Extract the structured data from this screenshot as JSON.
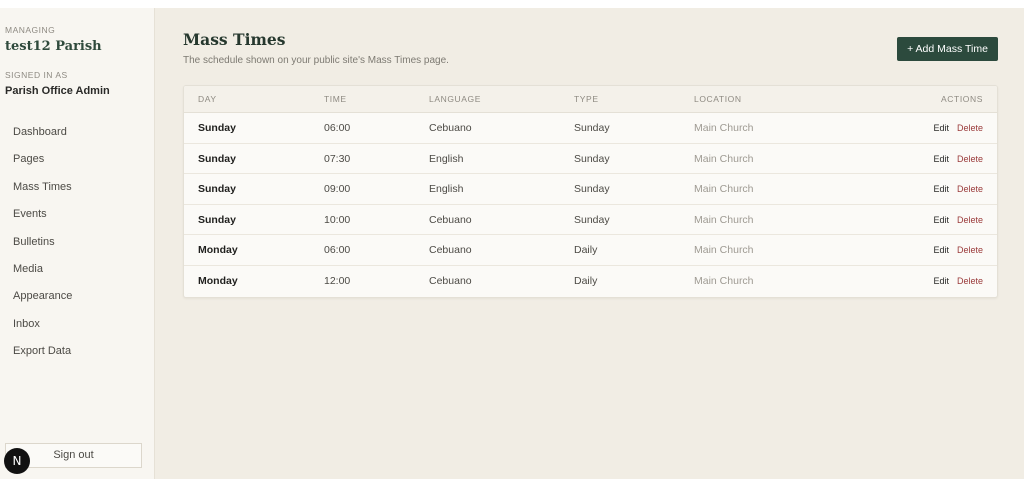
{
  "sidebar": {
    "managing_label": "MANAGING",
    "parish_name": "test12 Parish",
    "signed_in_label": "SIGNED IN AS",
    "user_name": "Parish Office Admin",
    "nav": [
      "Dashboard",
      "Pages",
      "Mass Times",
      "Events",
      "Bulletins",
      "Media",
      "Appearance",
      "Inbox",
      "Export Data"
    ],
    "sign_out": "Sign out",
    "badge": "N"
  },
  "main": {
    "title": "Mass Times",
    "subtitle": "The schedule shown on your public site's Mass Times page.",
    "add_button": "+ Add Mass Time"
  },
  "table": {
    "headers": {
      "day": "DAY",
      "time": "TIME",
      "language": "LANGUAGE",
      "type": "TYPE",
      "location": "LOCATION",
      "actions": "ACTIONS"
    },
    "edit_label": "Edit",
    "delete_label": "Delete",
    "rows": [
      {
        "day": "Sunday",
        "time": "06:00",
        "language": "Cebuano",
        "type": "Sunday",
        "location": "Main Church"
      },
      {
        "day": "Sunday",
        "time": "07:30",
        "language": "English",
        "type": "Sunday",
        "location": "Main Church"
      },
      {
        "day": "Sunday",
        "time": "09:00",
        "language": "English",
        "type": "Sunday",
        "location": "Main Church"
      },
      {
        "day": "Sunday",
        "time": "10:00",
        "language": "Cebuano",
        "type": "Sunday",
        "location": "Main Church"
      },
      {
        "day": "Monday",
        "time": "06:00",
        "language": "Cebuano",
        "type": "Daily",
        "location": "Main Church"
      },
      {
        "day": "Monday",
        "time": "12:00",
        "language": "Cebuano",
        "type": "Daily",
        "location": "Main Church"
      }
    ]
  },
  "colors": {
    "accent": "#2c4a3d",
    "delete": "#9a3a3a",
    "background": "#f1ede4"
  }
}
